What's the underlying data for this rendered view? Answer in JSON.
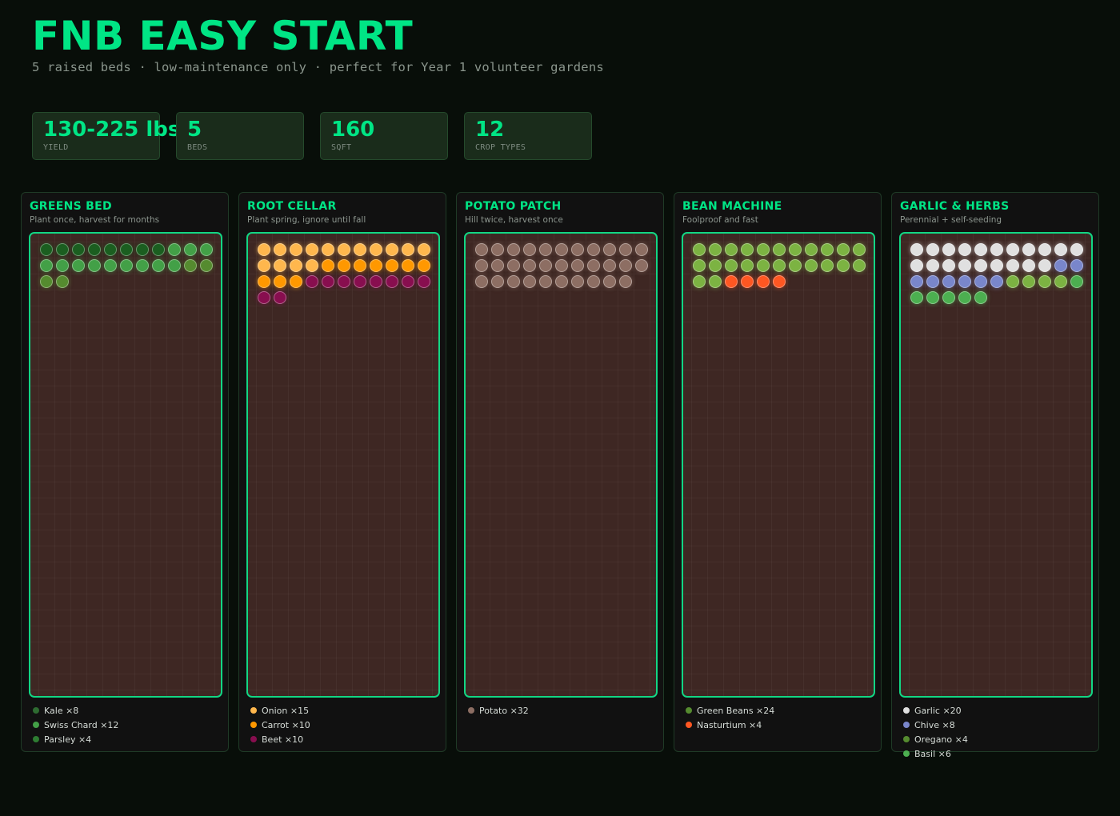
{
  "header": {
    "title": "FNB EASY START",
    "subtitle": "5 raised beds · low-maintenance only · perfect for Year 1 volunteer gardens"
  },
  "stats": [
    {
      "value": "130-225 lbs",
      "label": "YIELD"
    },
    {
      "value": "5",
      "label": "BEDS"
    },
    {
      "value": "160",
      "label": "SQFT"
    },
    {
      "value": "12",
      "label": "CROP TYPES"
    }
  ],
  "beds": [
    {
      "name": "GREENS BED",
      "description": "Plant once, harvest for months",
      "crops": [
        {
          "name": "Kale",
          "count": 8,
          "label": "Kale ×8",
          "color": "#1b5e20",
          "legend_color": "#2e6b31"
        },
        {
          "name": "Swiss Chard",
          "count": 12,
          "label": "Swiss Chard ×12",
          "color": "#43a047",
          "legend_color": "#43a047"
        },
        {
          "name": "Parsley",
          "count": 4,
          "label": "Parsley ×4",
          "color": "#558b2f",
          "legend_color": "#2e7d32"
        }
      ]
    },
    {
      "name": "ROOT CELLAR",
      "description": "Plant spring, ignore until fall",
      "crops": [
        {
          "name": "Onion",
          "count": 15,
          "label": "Onion ×15",
          "color": "#ffb74d",
          "legend_color": "#ffb74d"
        },
        {
          "name": "Carrot",
          "count": 10,
          "label": "Carrot ×10",
          "color": "#ff9800",
          "legend_color": "#ff9800"
        },
        {
          "name": "Beet",
          "count": 10,
          "label": "Beet ×10",
          "color": "#880e4f",
          "legend_color": "#880e4f"
        }
      ]
    },
    {
      "name": "POTATO PATCH",
      "description": "Hill twice, harvest once",
      "crops": [
        {
          "name": "Potato",
          "count": 32,
          "label": "Potato ×32",
          "color": "#8d6e63",
          "legend_color": "#8d6e63"
        }
      ]
    },
    {
      "name": "BEAN MACHINE",
      "description": "Foolproof and fast",
      "crops": [
        {
          "name": "Green Beans",
          "count": 24,
          "label": "Green Beans ×24",
          "color": "#7cb342",
          "legend_color": "#558b2f"
        },
        {
          "name": "Nasturtium",
          "count": 4,
          "label": "Nasturtium ×4",
          "color": "#ff5722",
          "legend_color": "#ff5722"
        }
      ]
    },
    {
      "name": "GARLIC & HERBS",
      "description": "Perennial + self-seeding",
      "crops": [
        {
          "name": "Garlic",
          "count": 20,
          "label": "Garlic ×20",
          "color": "#e0e0e0",
          "legend_color": "#e0e0e0"
        },
        {
          "name": "Chive",
          "count": 8,
          "label": "Chive ×8",
          "color": "#7986cb",
          "legend_color": "#7986cb"
        },
        {
          "name": "Oregano",
          "count": 4,
          "label": "Oregano ×4",
          "color": "#7cb342",
          "legend_color": "#558b2f"
        },
        {
          "name": "Basil",
          "count": 6,
          "label": "Basil ×6",
          "color": "#4caf50",
          "legend_color": "#4caf50"
        }
      ]
    }
  ]
}
